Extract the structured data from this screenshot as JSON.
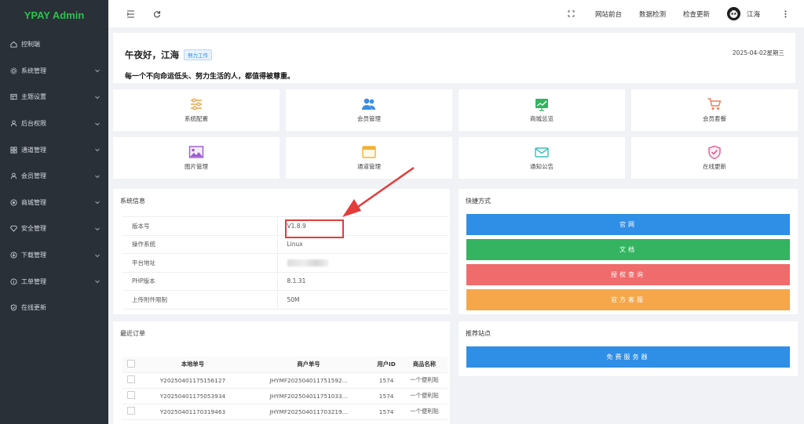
{
  "sidebar": {
    "logo": "YPAY Admin",
    "items": [
      {
        "label": "控制端",
        "icon": "home-icon",
        "arrow": false
      },
      {
        "label": "系统管理",
        "icon": "gear-icon",
        "arrow": true
      },
      {
        "label": "主题设置",
        "icon": "layout-icon",
        "arrow": true
      },
      {
        "label": "后台权限",
        "icon": "user-icon",
        "arrow": true
      },
      {
        "label": "通道管理",
        "icon": "grid-icon",
        "arrow": true
      },
      {
        "label": "会员管理",
        "icon": "user-icon",
        "arrow": true
      },
      {
        "label": "商城管理",
        "icon": "circle-icon",
        "arrow": true
      },
      {
        "label": "安全管理",
        "icon": "diamond-icon",
        "arrow": true
      },
      {
        "label": "下载管理",
        "icon": "download-icon",
        "arrow": true
      },
      {
        "label": "工单管理",
        "icon": "info-icon",
        "arrow": true
      },
      {
        "label": "在线更新",
        "icon": "shield-icon",
        "arrow": false
      }
    ]
  },
  "header": {
    "links": [
      "网站前台",
      "数据检测",
      "检查更新"
    ],
    "username": "江海"
  },
  "welcome": {
    "greeting": "午夜好，江海",
    "badge": "努力工作",
    "date": "2025-04-02星期三",
    "motto": "每一个不向命运低头、努力生活的人，都值得被尊重。"
  },
  "tiles": [
    {
      "label": "系统配置",
      "icon": "sliders-icon",
      "color": "#f2a443"
    },
    {
      "label": "会员管理",
      "icon": "users-icon",
      "color": "#3a8ee6"
    },
    {
      "label": "商城总览",
      "icon": "chart-icon",
      "color": "#34b460"
    },
    {
      "label": "会员套餐",
      "icon": "cart-icon",
      "color": "#f07a55"
    },
    {
      "label": "图片管理",
      "icon": "image-icon",
      "color": "#9c59d1"
    },
    {
      "label": "通道管理",
      "icon": "window-icon",
      "color": "#f3b233"
    },
    {
      "label": "通知公告",
      "icon": "mail-icon",
      "color": "#3cc0b5"
    },
    {
      "label": "在线更新",
      "icon": "shield-check-icon",
      "color": "#e7548f"
    }
  ],
  "system": {
    "title": "系统信息",
    "rows": [
      {
        "key": "版本号",
        "value": "V1.8.9"
      },
      {
        "key": "操作系统",
        "value": "Linux"
      },
      {
        "key": "平台地址",
        "value": ""
      },
      {
        "key": "PHP版本",
        "value": "8.1.31"
      },
      {
        "key": "上传附件限制",
        "value": "50M"
      }
    ]
  },
  "quick": {
    "title": "快捷方式",
    "buttons": [
      {
        "label": "官网",
        "color": "#2f8ee6"
      },
      {
        "label": "文档",
        "color": "#34b460"
      },
      {
        "label": "授权查询",
        "color": "#f06b6b"
      },
      {
        "label": "官方客服",
        "color": "#f5a74a"
      }
    ]
  },
  "orders": {
    "title": "最近订单",
    "columns": [
      "本地单号",
      "商户单号",
      "用户ID",
      "商品名称"
    ],
    "rows": [
      [
        "Y20250401175156127",
        "JHYMF202504011751592...",
        "1574",
        "一个便利贴"
      ],
      [
        "Y20250401175053934",
        "JHYMF202504011751033...",
        "1574",
        "一个便利贴"
      ],
      [
        "Y20250401170319463",
        "JHYMF202504011703219...",
        "1574",
        "一个便利贴"
      ]
    ]
  },
  "recommend": {
    "title": "推荐站点",
    "button": "免费服务器",
    "button_color": "#2f8ee6"
  },
  "annotation": {
    "color": "#e43b3b"
  }
}
